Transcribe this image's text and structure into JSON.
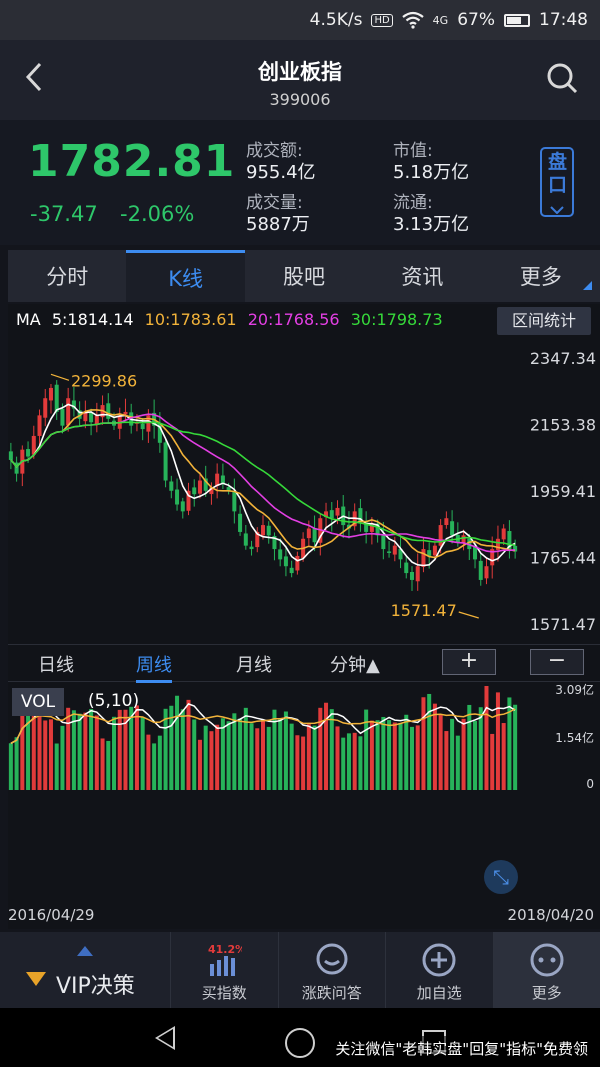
{
  "status_bar": {
    "speed": "4.5K/s",
    "hd": "HD",
    "net": "4G",
    "battery": "67%",
    "time": "17:48"
  },
  "header": {
    "title": "创业板指",
    "code": "399006"
  },
  "quote": {
    "price": "1782.81",
    "change": "-37.47",
    "change_pct": "-2.06%",
    "turnover_label": "成交额:",
    "turnover": "955.4亿",
    "volume_label": "成交量:",
    "volume": "5887万",
    "mktcap_label": "市值:",
    "mktcap": "5.18万亿",
    "float_label": "流通:",
    "float": "3.13万亿",
    "pankou_label": "盘口"
  },
  "tabs": [
    "分时",
    "K线",
    "股吧",
    "资讯",
    "更多"
  ],
  "chart_ma": {
    "ma_label": "MA",
    "ma5": "5:1814.14",
    "ma10": "10:1783.61",
    "ma20": "20:1768.56",
    "ma30": "30:1798.73",
    "range_button": "区间统计"
  },
  "chart_data": {
    "type": "candlestick",
    "period": "weekly",
    "y_ticks": [
      "2347.34",
      "2153.38",
      "1959.41",
      "1765.44",
      "1571.47"
    ],
    "ylim": [
      1571.47,
      2347.34
    ],
    "high_annotation": "2299.86",
    "low_annotation": "1571.47",
    "x_start": "2016/04/29",
    "x_end": "2018/04/20",
    "close": [
      2050,
      2010,
      2080,
      2060,
      2120,
      2180,
      2230,
      2260,
      2190,
      2150,
      2230,
      2200,
      2170,
      2190,
      2160,
      2180,
      2210,
      2170,
      2150,
      2180,
      2190,
      2150,
      2160,
      2140,
      2180,
      2150,
      2100,
      1990,
      1960,
      1920,
      1900,
      1960,
      1950,
      1990,
      1960,
      1970,
      2010,
      1980,
      1960,
      1900,
      1840,
      1800,
      1790,
      1840,
      1860,
      1830,
      1790,
      1760,
      1740,
      1720,
      1770,
      1820,
      1850,
      1810,
      1880,
      1900,
      1880,
      1910,
      1860,
      1850,
      1900,
      1870,
      1840,
      1860,
      1830,
      1790,
      1780,
      1800,
      1760,
      1720,
      1700,
      1740,
      1790,
      1770,
      1800,
      1860,
      1880,
      1830,
      1810,
      1830,
      1790,
      1760,
      1700,
      1740,
      1790,
      1820,
      1850,
      1790,
      1782.81
    ],
    "ma_series": [
      {
        "name": "MA5",
        "color": "#ffffff"
      },
      {
        "name": "MA10",
        "color": "#f2b33a"
      },
      {
        "name": "MA20",
        "color": "#e33fe3"
      },
      {
        "name": "MA30",
        "color": "#36d93a"
      }
    ],
    "colors": {
      "up": "#e23b3b",
      "down": "#27b35a"
    }
  },
  "period_tabs": {
    "day": "日线",
    "week": "周线",
    "month": "月线",
    "minute": "分钟▲",
    "plus": "+",
    "minus": "−"
  },
  "vol_panel": {
    "label": "VOL",
    "params": "(5,10)",
    "y_ticks": [
      "3.09亿",
      "1.54亿",
      "0"
    ]
  },
  "bottom_nav": {
    "vip": "VIP决策",
    "items": [
      {
        "label": "买指数",
        "badge": "41.2%"
      },
      {
        "label": "涨跌问答"
      },
      {
        "label": "加自选"
      },
      {
        "label": "更多"
      }
    ]
  },
  "watermark": "关注微信\"老韩实盘\"回复\"指标\"免费领"
}
